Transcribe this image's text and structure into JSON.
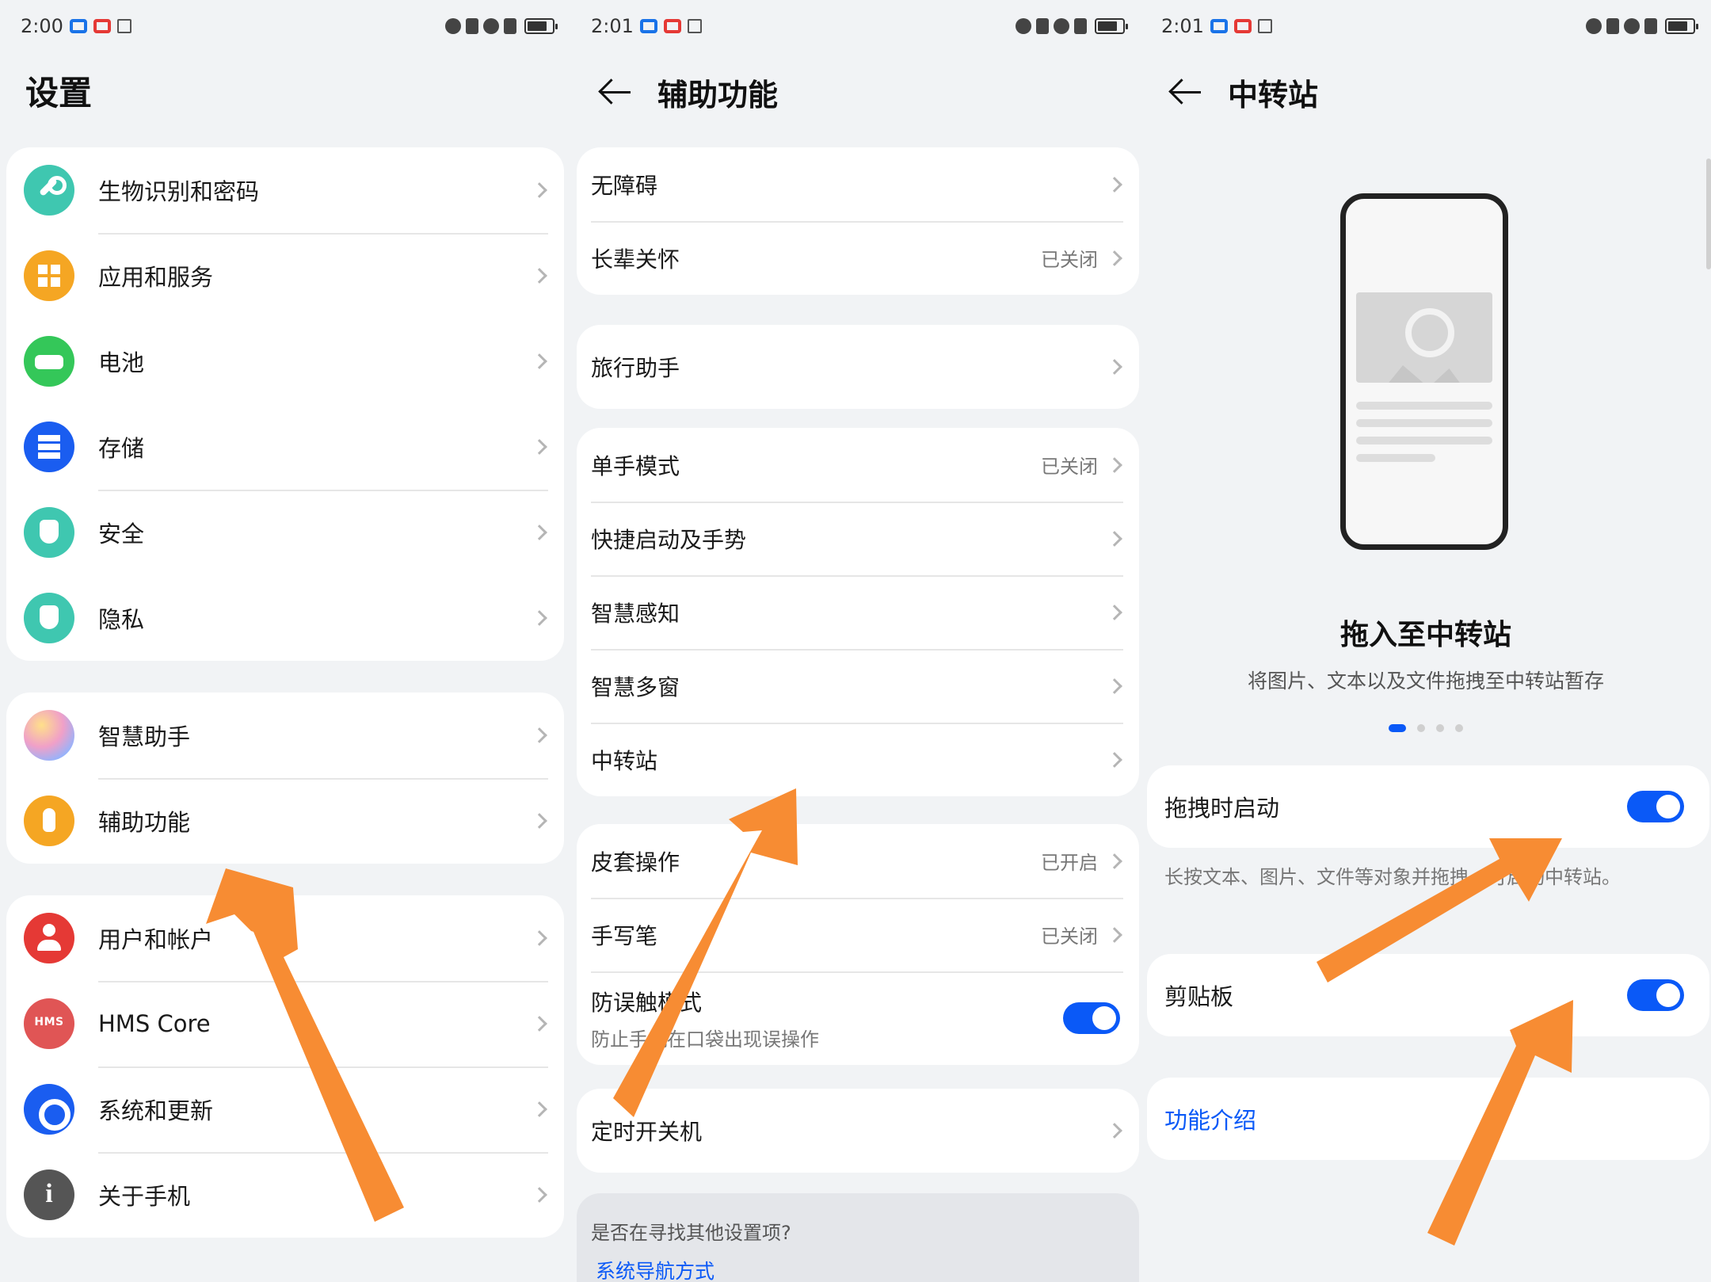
{
  "screen1": {
    "status": {
      "time": "2:00"
    },
    "title": "设置",
    "group1": [
      {
        "label": "生物识别和密码",
        "icon": "key-icon",
        "color": "#3fc7b0"
      },
      {
        "label": "应用和服务",
        "icon": "apps-grid-icon",
        "color": "#f5a623"
      },
      {
        "label": "电池",
        "icon": "battery-icon",
        "color": "#34c759"
      },
      {
        "label": "存储",
        "icon": "storage-icon",
        "color": "#1a5df0"
      },
      {
        "label": "安全",
        "icon": "shield-check-icon",
        "color": "#3fc7b0"
      },
      {
        "label": "隐私",
        "icon": "privacy-lock-icon",
        "color": "#3fc7b0"
      }
    ],
    "group2": [
      {
        "label": "智慧助手",
        "icon": "assistant-orb-icon",
        "color": "#f0a0c8"
      },
      {
        "label": "辅助功能",
        "icon": "hand-pointer-icon",
        "color": "#f5a623"
      }
    ],
    "group3": [
      {
        "label": "用户和帐户",
        "icon": "user-icon",
        "color": "#e53935"
      },
      {
        "label": "HMS Core",
        "icon": "hms-icon",
        "color": "#e05555",
        "badge": "HMS"
      },
      {
        "label": "系统和更新",
        "icon": "gear-icon",
        "color": "#1a5df0"
      },
      {
        "label": "关于手机",
        "icon": "info-icon",
        "color": "#555555",
        "badge": "i"
      }
    ]
  },
  "screen2": {
    "status": {
      "time": "2:01"
    },
    "title": "辅助功能",
    "group1": [
      {
        "label": "无障碍",
        "value": ""
      },
      {
        "label": "长辈关怀",
        "value": "已关闭"
      }
    ],
    "group2": [
      {
        "label": "旅行助手",
        "value": ""
      }
    ],
    "group3": [
      {
        "label": "单手模式",
        "value": "已关闭"
      },
      {
        "label": "快捷启动及手势",
        "value": ""
      },
      {
        "label": "智慧感知",
        "value": ""
      },
      {
        "label": "智慧多窗",
        "value": ""
      },
      {
        "label": "中转站",
        "value": ""
      }
    ],
    "group4": [
      {
        "label": "皮套操作",
        "value": "已开启"
      },
      {
        "label": "手写笔",
        "value": "已关闭"
      }
    ],
    "mistouch": {
      "label": "防误触模式",
      "desc": "防止手机在口袋出现误操作"
    },
    "group5": [
      {
        "label": "定时开关机",
        "value": ""
      }
    ],
    "search": {
      "question": "是否在寻找其他设置项?",
      "link": "系统导航方式"
    }
  },
  "screen3": {
    "status": {
      "time": "2:01"
    },
    "title": "中转站",
    "feature_title": "拖入至中转站",
    "feature_desc": "将图片、文本以及文件拖拽至中转站暂存",
    "drag_start": "拖拽时启动",
    "help": "长按文本、图片、文件等对象并拖拽，可启动中转站。",
    "clipboard": "剪贴板",
    "intro_link": "功能介绍"
  },
  "colors": {
    "accent": "#0a59f7",
    "arrow": "#f78c33"
  }
}
